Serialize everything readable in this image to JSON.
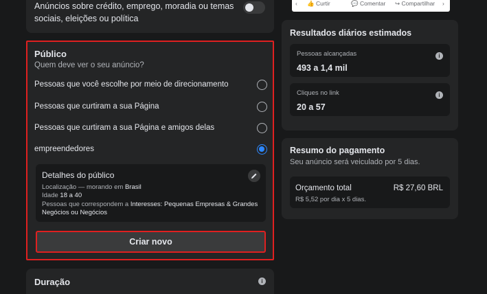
{
  "special_category": {
    "text": "Anúncios sobre crédito, emprego, moradia ou temas sociais, eleições ou política"
  },
  "audience": {
    "title": "Público",
    "subtitle": "Quem deve ver o seu anúncio?",
    "options": [
      {
        "label": "Pessoas que você escolhe por meio de direcionamento",
        "selected": false
      },
      {
        "label": "Pessoas que curtiram a sua Página",
        "selected": false
      },
      {
        "label": "Pessoas que curtiram a sua Página e amigos delas",
        "selected": false
      },
      {
        "label": "empreendedores",
        "selected": true
      }
    ],
    "details": {
      "title": "Detalhes do público",
      "location_label": "Localização — morando em",
      "location_value": "Brasil",
      "age_label": "Idade",
      "age_value": "18 a 40",
      "interests_label": "Pessoas que correspondem a",
      "interests_value_1": "Interesses: Pequenas Empresas & Grandes",
      "interests_value_2": "Negócios ou Negócios"
    },
    "create_button": "Criar novo"
  },
  "duration": {
    "title": "Duração"
  },
  "preview": {
    "like": "Curtir",
    "comment": "Comentar",
    "share": "Compartilhar"
  },
  "results": {
    "title": "Resultados diários estimados",
    "reach_label": "Pessoas alcançadas",
    "reach_value": "493 a 1,4 mil",
    "clicks_label": "Cliques no link",
    "clicks_value": "20 a 57"
  },
  "payment": {
    "title": "Resumo do pagamento",
    "subtitle": "Seu anúncio será veiculado por 5 dias.",
    "budget_label": "Orçamento total",
    "budget_value": "R$ 27,60 BRL",
    "budget_detail": "R$ 5,52 por dia x 5 dias."
  },
  "colors": {
    "background": "#18191a",
    "card": "#242526",
    "accent": "#2d88ff",
    "highlight": "#e02020"
  }
}
